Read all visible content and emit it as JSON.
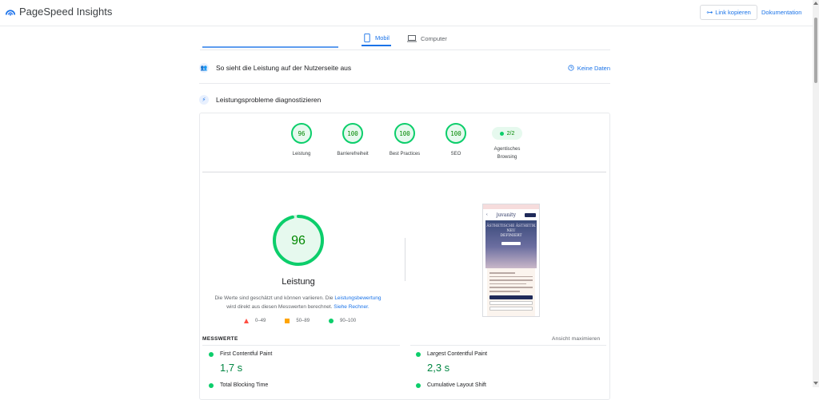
{
  "app": {
    "title": "PageSpeed Insights"
  },
  "header": {
    "copy_link": "Link kopieren",
    "docs": "Dokumentation"
  },
  "tabs": [
    {
      "label": "Mobil",
      "active": true
    },
    {
      "label": "Computer",
      "active": false
    }
  ],
  "field_data": {
    "title": "So sieht die Leistung auf der Nutzerseite aus",
    "status": "Keine Daten"
  },
  "diagnose": {
    "title": "Leistungsprobleme diagnostizieren"
  },
  "scores": [
    {
      "value": "96",
      "label": "Leistung"
    },
    {
      "value": "100",
      "label": "Barrierefreiheit"
    },
    {
      "value": "100",
      "label": "Best Practices"
    },
    {
      "value": "100",
      "label": "SEO"
    }
  ],
  "agentic": {
    "value": "2/2",
    "label_line1": "Agentisches",
    "label_line2": "Browsing"
  },
  "performance": {
    "score": "96",
    "score_fraction": 0.96,
    "label": "Leistung",
    "disclaimer_text": "Die Werte sind geschätzt und können variieren. Die ",
    "disclaimer_link": "Leistungsbewertung",
    "disclaimer_text2": " wird direkt aus diesen Messwerten berechnet. ",
    "calc_link": "Siehe Rechner."
  },
  "legend": [
    {
      "range": "0–49",
      "shape": "triangle",
      "color": "#ff4e42"
    },
    {
      "range": "50–89",
      "shape": "square",
      "color": "#ffa400"
    },
    {
      "range": "90–100",
      "shape": "circle",
      "color": "#0cce6b"
    }
  ],
  "preview": {
    "brand": "juvanity",
    "hero_line1": "ÄSTHETISCHE ÄSTHETIK",
    "hero_line2": "NEU",
    "hero_line3": "DEFINIERT"
  },
  "metrics": {
    "title": "MESSWERTE",
    "expand": "Ansicht maximieren",
    "items": [
      {
        "name": "First Contentful Paint",
        "value": "1,7 s"
      },
      {
        "name": "Largest Contentful Paint",
        "value": "2,3 s"
      },
      {
        "name": "Total Blocking Time",
        "value": ""
      },
      {
        "name": "Cumulative Layout Shift",
        "value": ""
      }
    ]
  },
  "colors": {
    "accent": "#1a73e8",
    "pass": "#0cce6b",
    "pass_text": "#008800"
  }
}
